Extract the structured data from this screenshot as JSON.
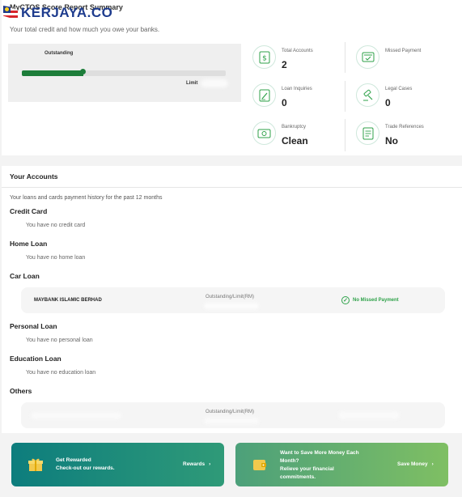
{
  "summary": {
    "title": "MyCTOS Score Report Summary",
    "subtitle": "Your total credit and how much you owe your banks.",
    "watermark": "KERJAYA.CO",
    "bar": {
      "outstanding_label": "Outstanding",
      "limit_label": "Limit",
      "fill_fraction": 0.3
    },
    "stats": [
      {
        "label": "Total Accounts",
        "value": "2",
        "icon": "dollar-document-icon"
      },
      {
        "label": "Missed Payment",
        "value": "",
        "icon": "missed-payment-card-icon"
      },
      {
        "label": "Loan Inquiries",
        "value": "0",
        "icon": "loan-inquiry-pen-icon"
      },
      {
        "label": "Legal Cases",
        "value": "0",
        "icon": "gavel-icon"
      },
      {
        "label": "Bankruptcy",
        "value": "Clean",
        "icon": "cash-icon"
      },
      {
        "label": "Trade References",
        "value": "No",
        "icon": "trade-reference-document-icon"
      }
    ]
  },
  "accounts": {
    "title": "Your Accounts",
    "subtitle": "Your loans and cards payment history for the past 12 months",
    "credit_card": {
      "label": "Credit Card",
      "empty": "You have no credit card"
    },
    "home_loan": {
      "label": "Home Loan",
      "empty": "You have no home loan"
    },
    "car_loan": {
      "label": "Car Loan",
      "rows": [
        {
          "bank": "MAYBANK ISLAMIC BERHAD",
          "outstanding_label": "Outstanding/Limit(RM)",
          "status": "No Missed Payment"
        }
      ]
    },
    "personal_loan": {
      "label": "Personal Loan",
      "empty": "You have no personal loan"
    },
    "education_loan": {
      "label": "Education Loan",
      "empty": "You have no education loan"
    },
    "others": {
      "label": "Others",
      "rows": [
        {
          "outstanding_label": "Outstanding/Limit(RM)"
        }
      ]
    }
  },
  "promos": {
    "rewards": {
      "title": "Get Rewarded",
      "subtitle": "Check-out our rewards.",
      "link": "Rewards"
    },
    "save": {
      "line1": "Want to Save More Money Each",
      "line2": "Month?",
      "line3": "Relieve your financial",
      "line4": "commitments.",
      "link": "Save Money"
    }
  },
  "colors": {
    "brand_green": "#1d7d3a",
    "accent_green": "#2fa24a",
    "teal": "#0d7d7d"
  }
}
